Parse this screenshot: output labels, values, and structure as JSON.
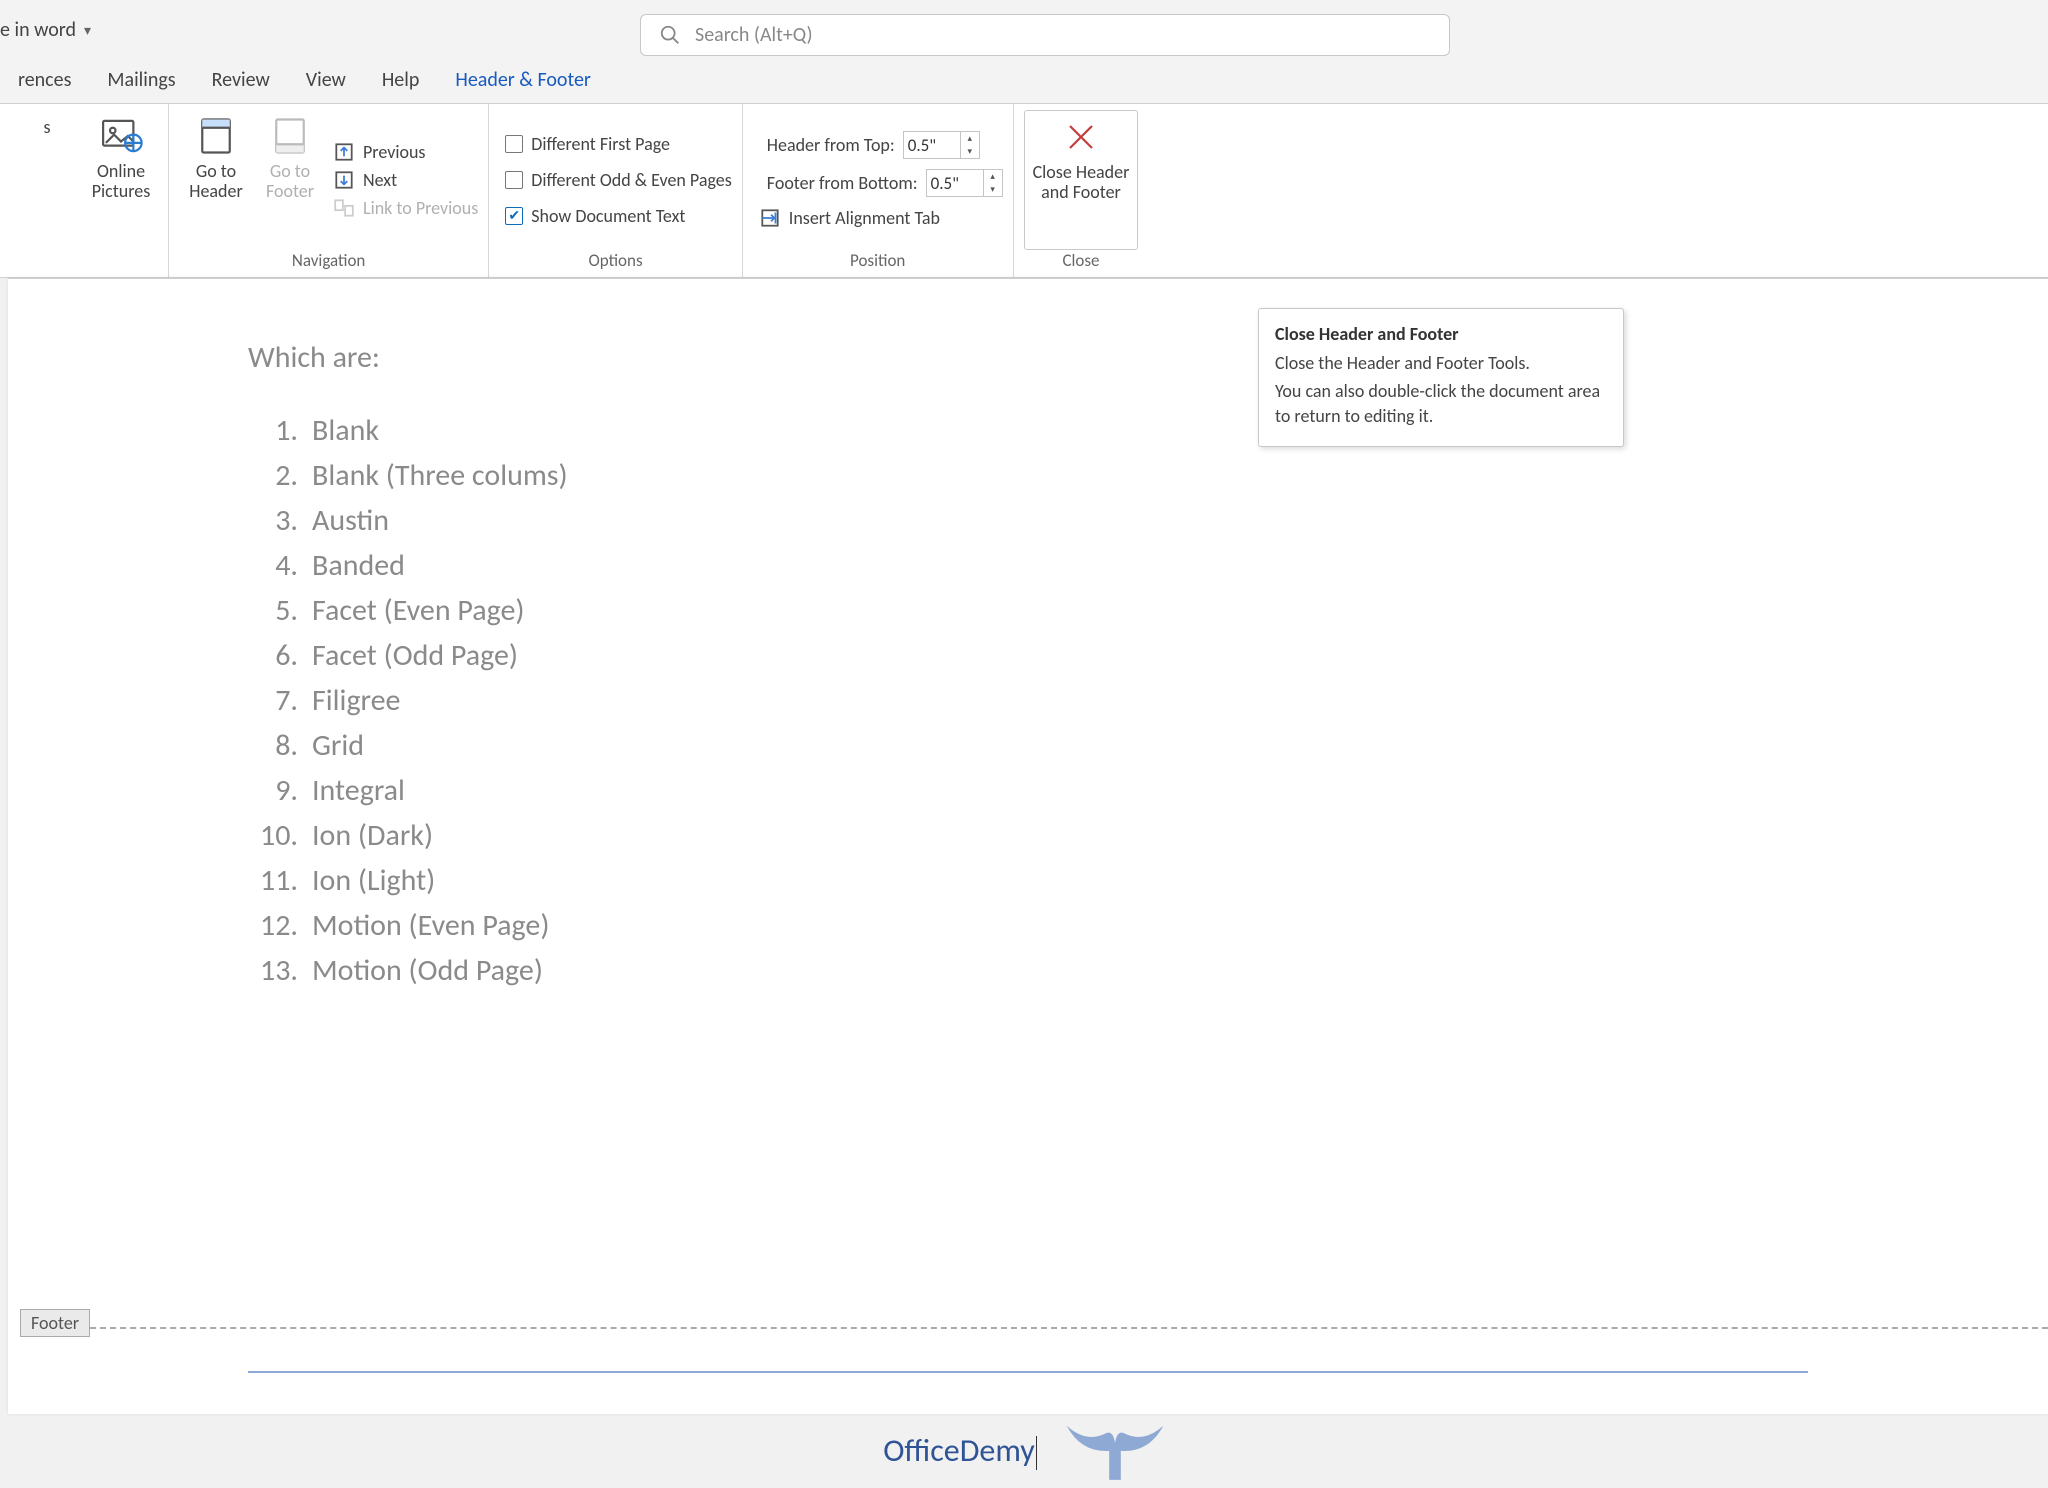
{
  "titlebar": {
    "docname_fragment": "e in word",
    "search_placeholder": "Search (Alt+Q)"
  },
  "tabs": {
    "references": "rences",
    "mailings": "Mailings",
    "review": "Review",
    "view": "View",
    "help": "Help",
    "header_footer": "Header & Footer"
  },
  "ribbon": {
    "pictures_frag": "s",
    "online_pictures": "Online",
    "online_pictures2": "Pictures",
    "nav_group": "Navigation",
    "goto_header": "Go to",
    "goto_header2": "Header",
    "goto_footer": "Go to",
    "goto_footer2": "Footer",
    "previous": "Previous",
    "next": "Next",
    "link_prev": "Link to Previous",
    "options_group": "Options",
    "diff_first": "Different First Page",
    "diff_oddeven": "Different Odd & Even Pages",
    "show_doc": "Show Document Text",
    "position_group": "Position",
    "header_top": "Header from Top:",
    "footer_bottom": "Footer from Bottom:",
    "header_top_val": "0.5\"",
    "footer_bottom_val": "0.5\"",
    "insert_align": "Insert Alignment Tab",
    "close_group": "Close",
    "close_header": "Close Header",
    "close_footer": "and Footer"
  },
  "tooltip": {
    "title": "Close Header and Footer",
    "line1": "Close the Header and Footer Tools.",
    "line2": "You can also double-click the document area to return to editing it."
  },
  "document": {
    "heading": "Which are:",
    "items": [
      "Blank",
      "Blank (Three colums)",
      "Austin",
      "Banded",
      "Facet (Even Page)",
      "Facet (Odd Page)",
      "Filigree",
      "Grid",
      "Integral",
      "Ion (Dark)",
      "Ion (Light)",
      "Motion (Even Page)",
      "Motion (Odd Page)"
    ],
    "footer_tag": "Footer",
    "footer_text": "OfficeDemy"
  }
}
